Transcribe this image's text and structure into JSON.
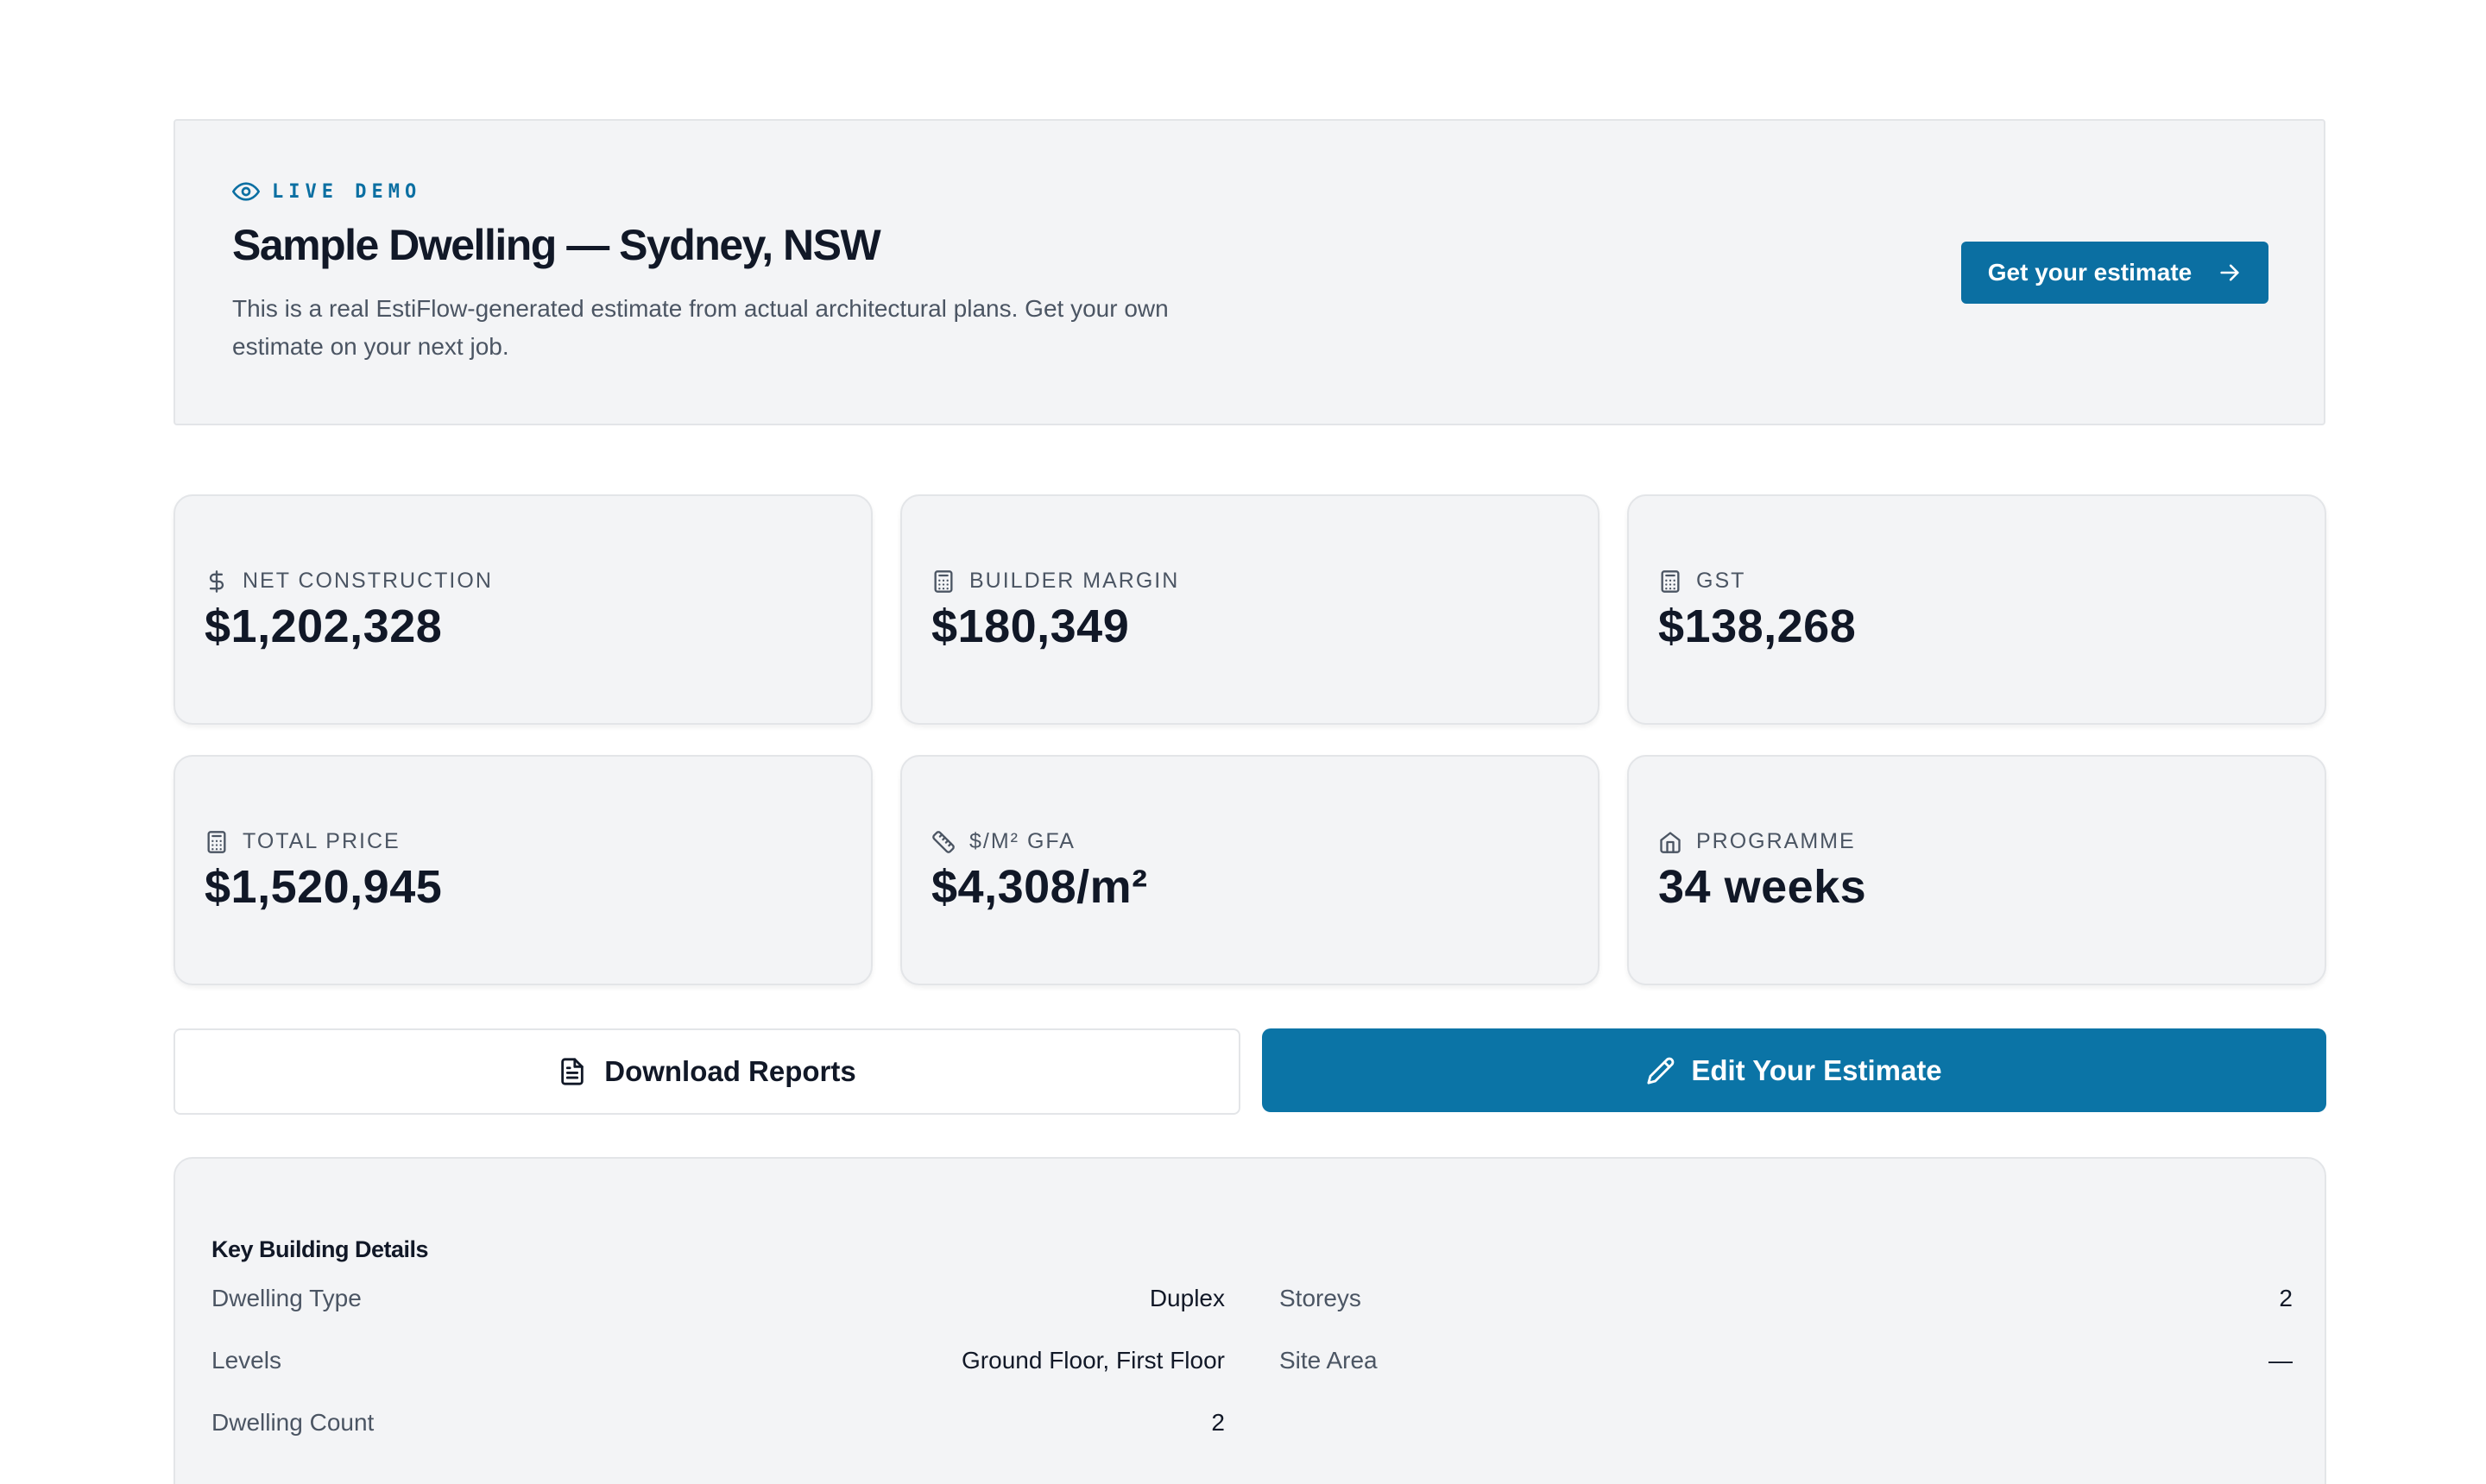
{
  "hero": {
    "badge": "LIVE DEMO",
    "title": "Sample Dwelling — Sydney, NSW",
    "description": "This is a real EstiFlow-generated estimate from actual architectural plans. Get your own estimate on your next job.",
    "cta_label": "Get your estimate"
  },
  "stats": [
    {
      "label": "NET CONSTRUCTION",
      "value": "$1,202,328",
      "icon": "dollar-icon"
    },
    {
      "label": "BUILDER MARGIN",
      "value": "$180,349",
      "icon": "calculator-icon"
    },
    {
      "label": "GST",
      "value": "$138,268",
      "icon": "calculator-icon"
    },
    {
      "label": "TOTAL PRICE",
      "value": "$1,520,945",
      "icon": "calculator-icon"
    },
    {
      "label": "$/M² GFA",
      "value": "$4,308/m²",
      "icon": "ruler-icon"
    },
    {
      "label": "PROGRAMME",
      "value": "34 weeks",
      "icon": "home-icon"
    }
  ],
  "actions": {
    "download_label": "Download Reports",
    "edit_label": "Edit Your Estimate"
  },
  "details": {
    "title": "Key Building Details",
    "left": [
      {
        "key": "Dwelling Type",
        "value": "Duplex"
      },
      {
        "key": "Levels",
        "value": "Ground Floor, First Floor"
      },
      {
        "key": "Dwelling Count",
        "value": "2"
      }
    ],
    "right": [
      {
        "key": "Storeys",
        "value": "2"
      },
      {
        "key": "Site Area",
        "value": "—"
      }
    ]
  },
  "colors": {
    "accent": "#0b6fa2",
    "panel": "#f3f4f6",
    "border": "#e3e5e8"
  }
}
